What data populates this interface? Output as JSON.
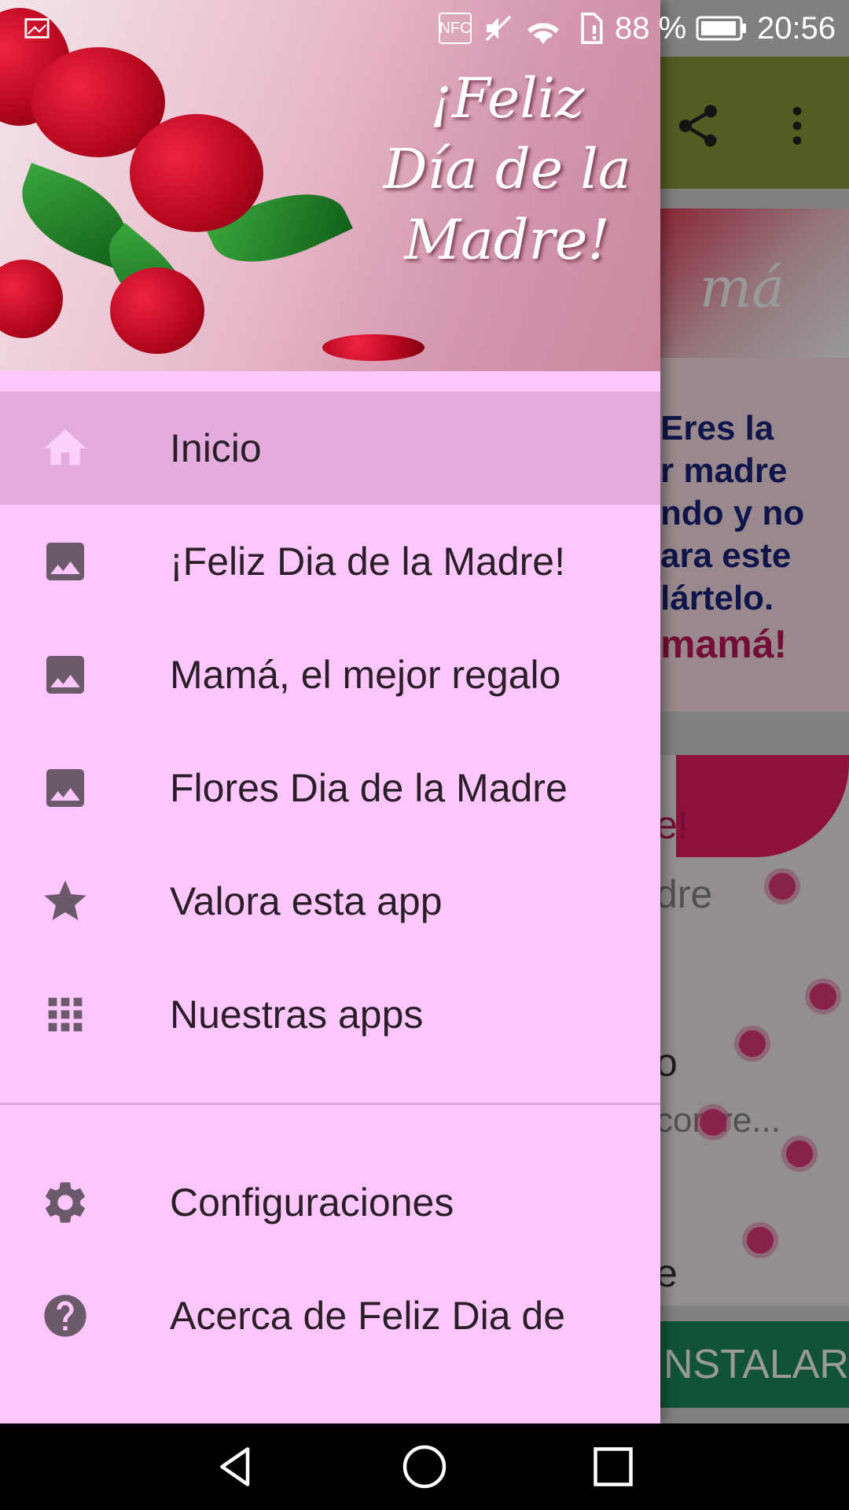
{
  "status_bar": {
    "battery_percent": "88 %",
    "time": "20:56",
    "nfc_label": "NFC",
    "icons": [
      "screenshot-icon",
      "nfc-icon",
      "silent-icon",
      "wifi-icon",
      "sim-alert-icon",
      "battery-icon"
    ]
  },
  "app": {
    "toolbar_color": "#8c9a3a",
    "toolbar_icons": [
      "share-icon",
      "more-vert-icon"
    ],
    "card1": {
      "header_word": "má",
      "lines": [
        "Eres la",
        "r madre",
        "ndo y no",
        "ara este",
        "lártelo.",
        "mamá!"
      ]
    },
    "card2": {
      "texts": [
        "e!",
        "dre",
        "o",
        "con re...",
        "e"
      ]
    },
    "install_label": "NSTALAR"
  },
  "drawer": {
    "background": "#fdc6fd",
    "selected_background": "#e3acdc",
    "header": {
      "title_lines": [
        "¡Feliz",
        "Día de la",
        "Madre!"
      ]
    },
    "items": [
      {
        "label": "Inicio",
        "icon": "home-icon",
        "selected": true
      },
      {
        "label": "¡Feliz Dia de la Madre!",
        "icon": "image-icon"
      },
      {
        "label": "Mamá, el mejor regalo",
        "icon": "image-icon"
      },
      {
        "label": "Flores Dia de la Madre",
        "icon": "image-icon"
      },
      {
        "label": "Valora esta app",
        "icon": "star-icon"
      },
      {
        "label": "Nuestras apps",
        "icon": "apps-grid-icon"
      }
    ],
    "secondary_items": [
      {
        "label": "Configuraciones",
        "icon": "settings-gear-icon"
      },
      {
        "label": "Acerca de Feliz Dia de",
        "icon": "help-icon"
      }
    ]
  },
  "nav_bar": {
    "buttons": [
      "back-icon",
      "home-circle-icon",
      "recents-icon"
    ]
  }
}
